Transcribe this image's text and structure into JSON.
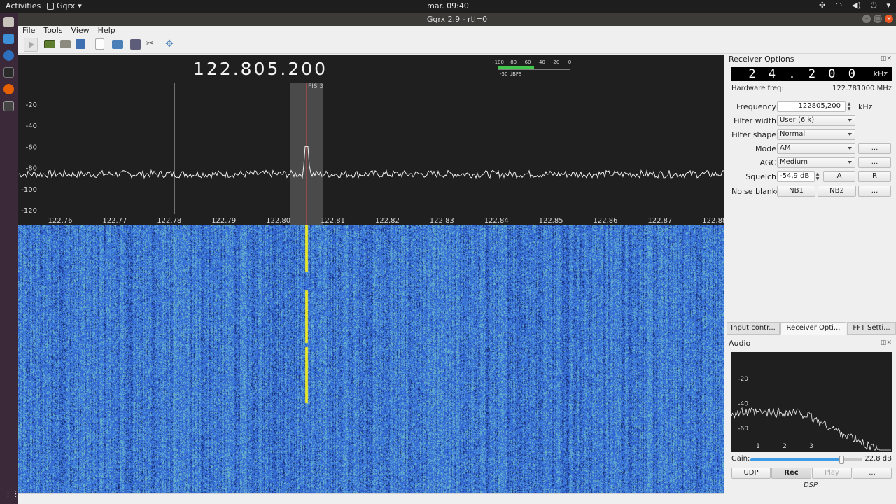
{
  "topbar": {
    "activities": "Activities",
    "app_name": "Gqrx",
    "clock": "mar. 09:40"
  },
  "window": {
    "title": "Gqrx 2.9 - rtl=0"
  },
  "menu": [
    "File",
    "Tools",
    "View",
    "Help"
  ],
  "plotter": {
    "frequency": "122.805.200",
    "filter_label": "FIS 3",
    "meter_scale": [
      "-100",
      "-80",
      "-60",
      "-40",
      "-20",
      "0"
    ],
    "meter_value": "-50 dBFS",
    "meter_level_db": -50,
    "y_ticks": [
      "-20",
      "-40",
      "-60",
      "-80",
      "-100",
      "-120"
    ],
    "x_ticks": [
      "122.76",
      "122.77",
      "122.78",
      "122.79",
      "122.80",
      "122.81",
      "122.82",
      "122.83",
      "122.84",
      "122.85",
      "122.86",
      "122.87",
      "122.88"
    ]
  },
  "receiver": {
    "title": "Receiver Options",
    "lcd_value": "24.200",
    "lcd_unit": "kHz",
    "hw_freq_label": "Hardware freq:",
    "hw_freq_value": "122.781000 MHz",
    "frequency_label": "Frequency",
    "frequency_value": "122805,200",
    "frequency_unit": "kHz",
    "filter_width_label": "Filter width",
    "filter_width_value": "User (6 k)",
    "filter_shape_label": "Filter shape",
    "filter_shape_value": "Normal",
    "mode_label": "Mode",
    "mode_value": "AM",
    "agc_label": "AGC",
    "agc_value": "Medium",
    "squelch_label": "Squelch",
    "squelch_value": "-54,9 dB",
    "squelch_auto": "A",
    "squelch_reset": "R",
    "noise_blanker_label": "Noise blanker",
    "nb1": "NB1",
    "nb2": "NB2",
    "more": "..."
  },
  "tabs": [
    "Input contr...",
    "Receiver Opti...",
    "FFT Setti..."
  ],
  "audio": {
    "title": "Audio",
    "y_ticks": [
      "-20",
      "-40",
      "-60"
    ],
    "x_ticks": [
      "1",
      "2",
      "3"
    ],
    "gain_label": "Gain:",
    "gain_value": "22.8 dB",
    "gain_fraction": 0.82,
    "udp": "UDP",
    "rec": "Rec",
    "play": "Play",
    "more": "...",
    "dsp": "DSP"
  }
}
